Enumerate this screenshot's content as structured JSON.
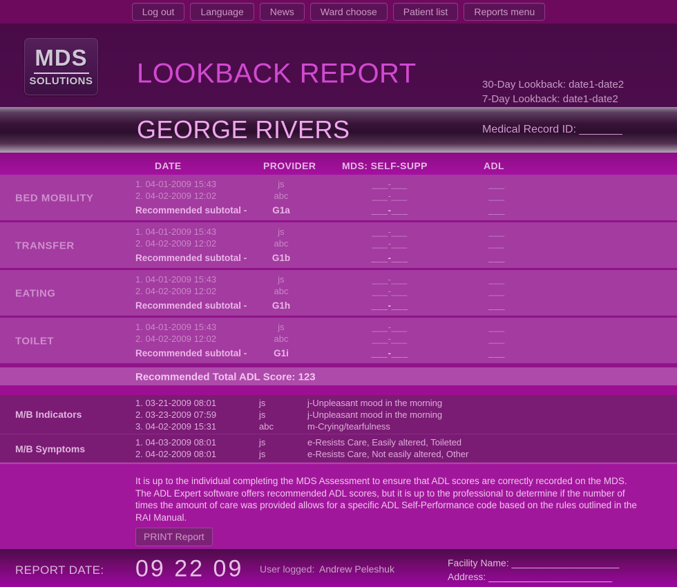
{
  "topnav": {
    "buttons": [
      {
        "label": "Log out",
        "name": "nav-log-out"
      },
      {
        "label": "Language",
        "name": "nav-language"
      },
      {
        "label": "News",
        "name": "nav-news"
      },
      {
        "label": "Ward choose",
        "name": "nav-ward-choose"
      },
      {
        "label": "Patient list",
        "name": "nav-patient-list"
      },
      {
        "label": "Reports menu",
        "name": "nav-reports-menu"
      }
    ]
  },
  "header": {
    "logo_main": "MDS",
    "logo_sub": "SOLUTIONS",
    "title": "LOOKBACK REPORT",
    "lookback_30": "30-Day Lookback: date1-date2",
    "lookback_7": "7-Day Lookback: date1-date2"
  },
  "patient": {
    "name": "GEORGE RIVERS",
    "medical_record_id_label": "Medical Record ID: _______"
  },
  "table": {
    "columns": {
      "date": "DATE",
      "provider": "PROVIDER",
      "mds_self_supp": "MDS: SELF-SUPP",
      "adl": "ADL"
    },
    "subtotal_label": "Recommended subtotal -",
    "rows": [
      {
        "label": "BED MOBILITY",
        "entries": [
          {
            "date": "1. 04-01-2009 15:43",
            "provider": "js",
            "mds": "___-___",
            "adl": "___"
          },
          {
            "date": "2. 04-02-2009 12:02",
            "provider": "abc",
            "mds": "___-___",
            "adl": "___"
          }
        ],
        "subtotal_code": "G1a",
        "subtotal_mds": "___-___",
        "subtotal_adl": "___"
      },
      {
        "label": "TRANSFER",
        "entries": [
          {
            "date": "1. 04-01-2009 15:43",
            "provider": "js",
            "mds": "___-___",
            "adl": "___"
          },
          {
            "date": "2. 04-02-2009 12:02",
            "provider": "abc",
            "mds": "___-___",
            "adl": "___"
          }
        ],
        "subtotal_code": "G1b",
        "subtotal_mds": "___-___",
        "subtotal_adl": "___"
      },
      {
        "label": "EATING",
        "entries": [
          {
            "date": "1. 04-01-2009 15:43",
            "provider": "js",
            "mds": "___-___",
            "adl": "___"
          },
          {
            "date": "2. 04-02-2009 12:02",
            "provider": "abc",
            "mds": "___-___",
            "adl": "___"
          }
        ],
        "subtotal_code": "G1h",
        "subtotal_mds": "___-___",
        "subtotal_adl": "___"
      },
      {
        "label": "TOILET",
        "entries": [
          {
            "date": "1. 04-01-2009 15:43",
            "provider": "js",
            "mds": "___-___",
            "adl": "___"
          },
          {
            "date": "2. 04-02-2009 12:02",
            "provider": "abc",
            "mds": "___-___",
            "adl": "___"
          }
        ],
        "subtotal_code": "G1i",
        "subtotal_mds": "___-___",
        "subtotal_adl": "___"
      }
    ],
    "total_label": "Recommended Total ADL Score: 123"
  },
  "mb_indicators": {
    "label": "M/B Indicators",
    "entries": [
      {
        "date": "1. 03-21-2009 08:01",
        "provider": "js",
        "description": "j-Unpleasant mood in the morning"
      },
      {
        "date": "2. 03-23-2009 07:59",
        "provider": "js",
        "description": "j-Unpleasant mood in the morning"
      },
      {
        "date": "3. 04-02-2009 15:31",
        "provider": "abc",
        "description": "m-Crying/tearfulness"
      }
    ]
  },
  "mb_symptoms": {
    "label": "M/B Symptoms",
    "entries": [
      {
        "date": "1. 04-03-2009 08:01",
        "provider": "js",
        "description": "e-Resists Care, Easily altered, Toileted"
      },
      {
        "date": "2. 04-02-2009 08:01",
        "provider": "js",
        "description": "e-Resists Care, Not easily altered, Other"
      }
    ]
  },
  "disclaimer": {
    "text": "It is up to the individual completing the MDS Assessment to ensure that ADL scores are correctly recorded on the MDS. The ADL Expert software offers recommended ADL scores, but it is up to the professional to determine if the number of times the amount of care was provided allows for a specific ADL Self-Performance code based on the rules outlined in the RAI Manual.",
    "print_button": "PRINT Report"
  },
  "footer": {
    "report_date_label": "REPORT DATE:",
    "report_date_value": "09 22 09",
    "user_logged_label": "User logged:",
    "user_name": "Andrew Peleshuk",
    "facility_name": "Facility Name: ____________________",
    "address": "Address: _______________________"
  },
  "colors": {
    "page_bg": "#a13ba0",
    "nav_bg": "#6e0a5e",
    "header_bg": "#4b0b4a",
    "accent_magenta": "#d04ad0",
    "patient_name": "#f0a6ee",
    "col_head_bg": "#9c0f92",
    "row_bg": "#a33ba0",
    "mb_row_bg": "#7a1b74",
    "disclaimer_bg": "#a1179b"
  }
}
